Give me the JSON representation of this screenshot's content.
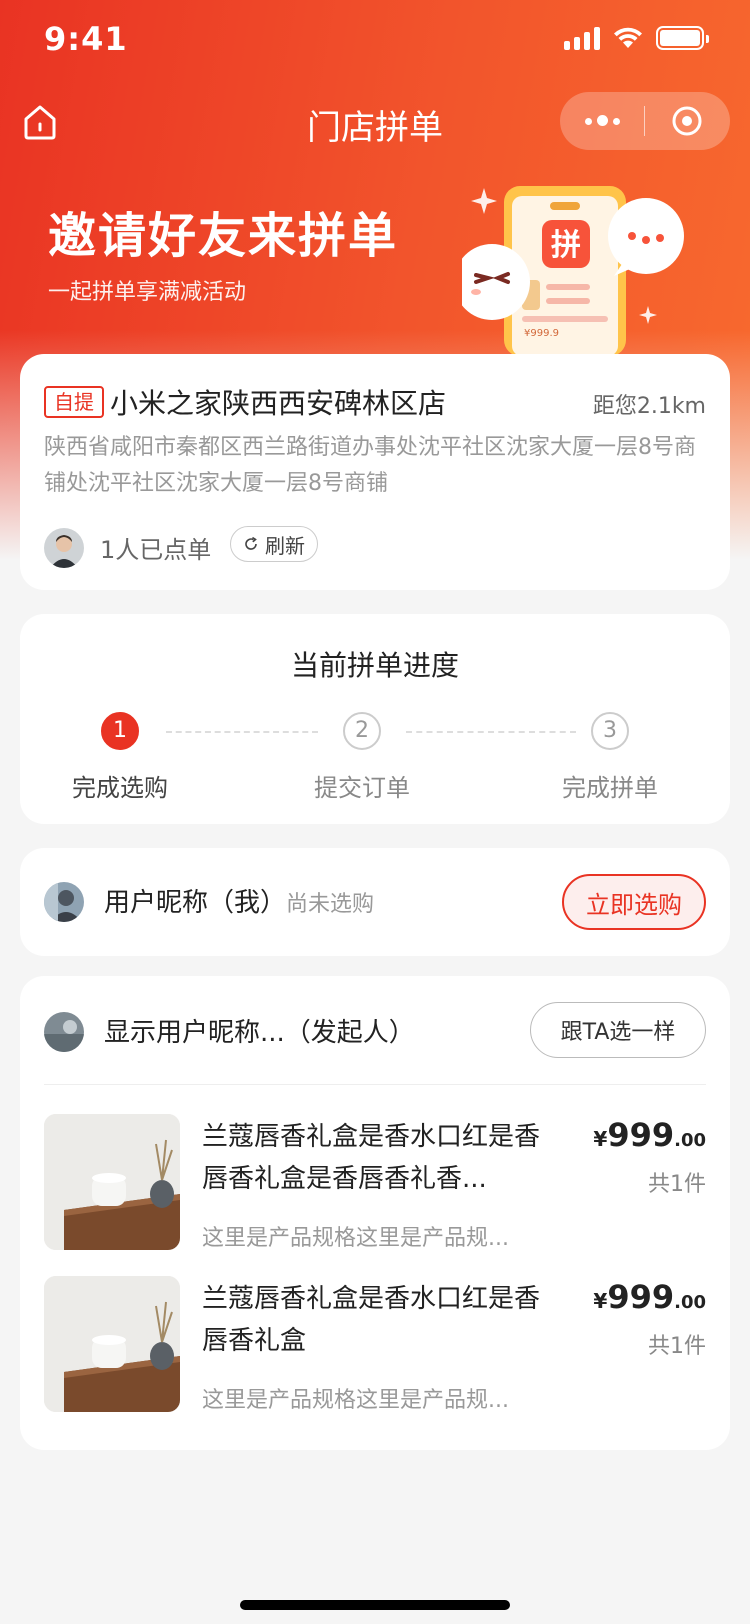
{
  "status_bar": {
    "time": "9:41"
  },
  "nav": {
    "title": "门店拼单"
  },
  "banner": {
    "title": "邀请好友来拼单",
    "subtitle": "一起拼单享满减活动",
    "illustration_badge": "拼",
    "illustration_price": "¥999.9"
  },
  "store": {
    "tag": "自提",
    "name": "小米之家陕西西安碑林区店",
    "distance": "距您2.1km",
    "address": "陕西省咸阳市秦都区西兰路街道办事处沈平社区沈家大厦一层8号商铺处沈平社区沈家大厦一层8号商铺",
    "order_count": "1人已点单",
    "refresh_label": "刷新"
  },
  "progress": {
    "title": "当前拼单进度",
    "steps": [
      {
        "num": "1",
        "label": "完成选购"
      },
      {
        "num": "2",
        "label": "提交订单"
      },
      {
        "num": "3",
        "label": "完成拼单"
      }
    ],
    "current_step": 1
  },
  "me": {
    "name": "用户昵称（我）",
    "status": "尚未选购",
    "button": "立即选购"
  },
  "group": {
    "host_name": "显示用户昵称...（发起人）",
    "button": "跟TA选一样",
    "products": [
      {
        "name": "兰蔻唇香礼盒是香水口红是香唇香礼盒是香唇香礼香...",
        "spec": "这里是产品规格这里是产品规...",
        "price_symbol": "¥",
        "price_int": "999",
        "price_dec": ".00",
        "qty": "共1件"
      },
      {
        "name": "兰蔻唇香礼盒是香水口红是香唇香礼盒",
        "spec": "这里是产品规格这里是产品规...",
        "price_symbol": "¥",
        "price_int": "999",
        "price_dec": ".00",
        "qty": "共1件"
      }
    ]
  },
  "colors": {
    "primary": "#e93323",
    "gradient_end": "#f86a2e",
    "background": "#f5f5f5"
  },
  "icons": [
    "home-icon",
    "more-dots-icon",
    "close-target-icon",
    "refresh-icon",
    "signal-icon",
    "wifi-icon",
    "battery-icon"
  ]
}
